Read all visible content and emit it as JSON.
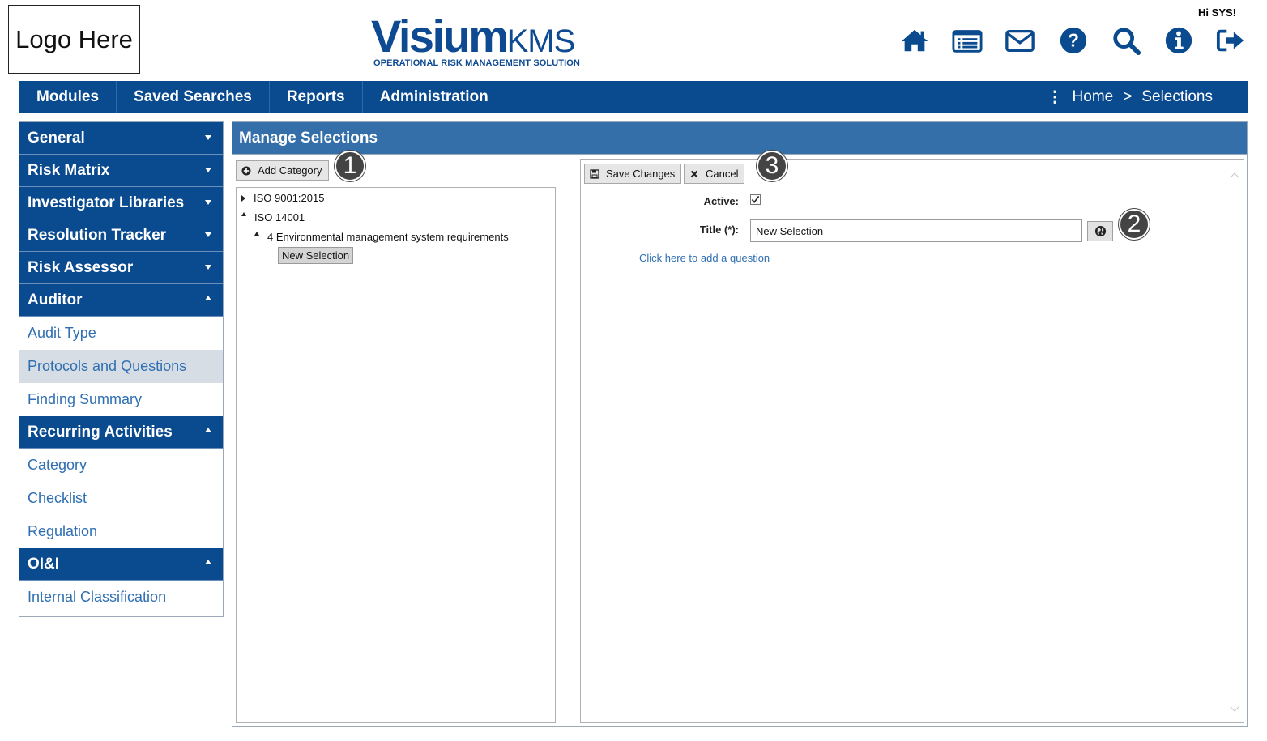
{
  "header": {
    "logo_text": "Logo Here",
    "brand_name": "Visium",
    "brand_suffix": "KMS",
    "brand_tagline": "OPERATIONAL RISK MANAGEMENT SOLUTION",
    "greeting": "Hi SYS!",
    "icons": [
      "home-icon",
      "list-icon",
      "mail-icon",
      "help-icon",
      "search-icon",
      "info-icon",
      "logout-icon"
    ]
  },
  "navbar": {
    "items": [
      "Modules",
      "Saved Searches",
      "Reports",
      "Administration"
    ],
    "breadcrumb": {
      "home": "Home",
      "separator": ">",
      "current": "Selections"
    }
  },
  "sidebar": {
    "sections": [
      {
        "label": "General",
        "expanded": false
      },
      {
        "label": "Risk Matrix",
        "expanded": false
      },
      {
        "label": "Investigator Libraries",
        "expanded": false
      },
      {
        "label": "Resolution Tracker",
        "expanded": false
      },
      {
        "label": "Risk Assessor",
        "expanded": false
      },
      {
        "label": "Auditor",
        "expanded": true,
        "items": [
          "Audit Type",
          "Protocols and Questions",
          "Finding Summary"
        ],
        "active_item": "Protocols and Questions"
      },
      {
        "label": "Recurring Activities",
        "expanded": true,
        "items": [
          "Category",
          "Checklist",
          "Regulation"
        ]
      },
      {
        "label": "OI&I",
        "expanded": true,
        "items": [
          "Internal Classification"
        ]
      }
    ]
  },
  "main": {
    "title": "Manage Selections",
    "add_category_label": "Add Category",
    "tree": {
      "nodes": [
        {
          "label": "ISO 9001:2015",
          "expanded": false,
          "level": 0
        },
        {
          "label": "ISO 14001",
          "expanded": true,
          "level": 0
        },
        {
          "label": "4 Environmental management system requirements",
          "expanded": true,
          "level": 1
        }
      ],
      "selected_node": "New Selection"
    },
    "editor": {
      "save_label": "Save Changes",
      "cancel_label": "Cancel",
      "active_label": "Active:",
      "active_checked": true,
      "title_label": "Title (*):",
      "title_value": "New Selection",
      "add_question_link": "Click here to add a question"
    },
    "callouts": [
      "1",
      "2",
      "3"
    ]
  },
  "colors": {
    "nav_blue": "#0a4a8f",
    "panel_title_blue": "#346fa9",
    "link_blue": "#2f6fb1",
    "active_item_bg": "#d6dde4"
  }
}
